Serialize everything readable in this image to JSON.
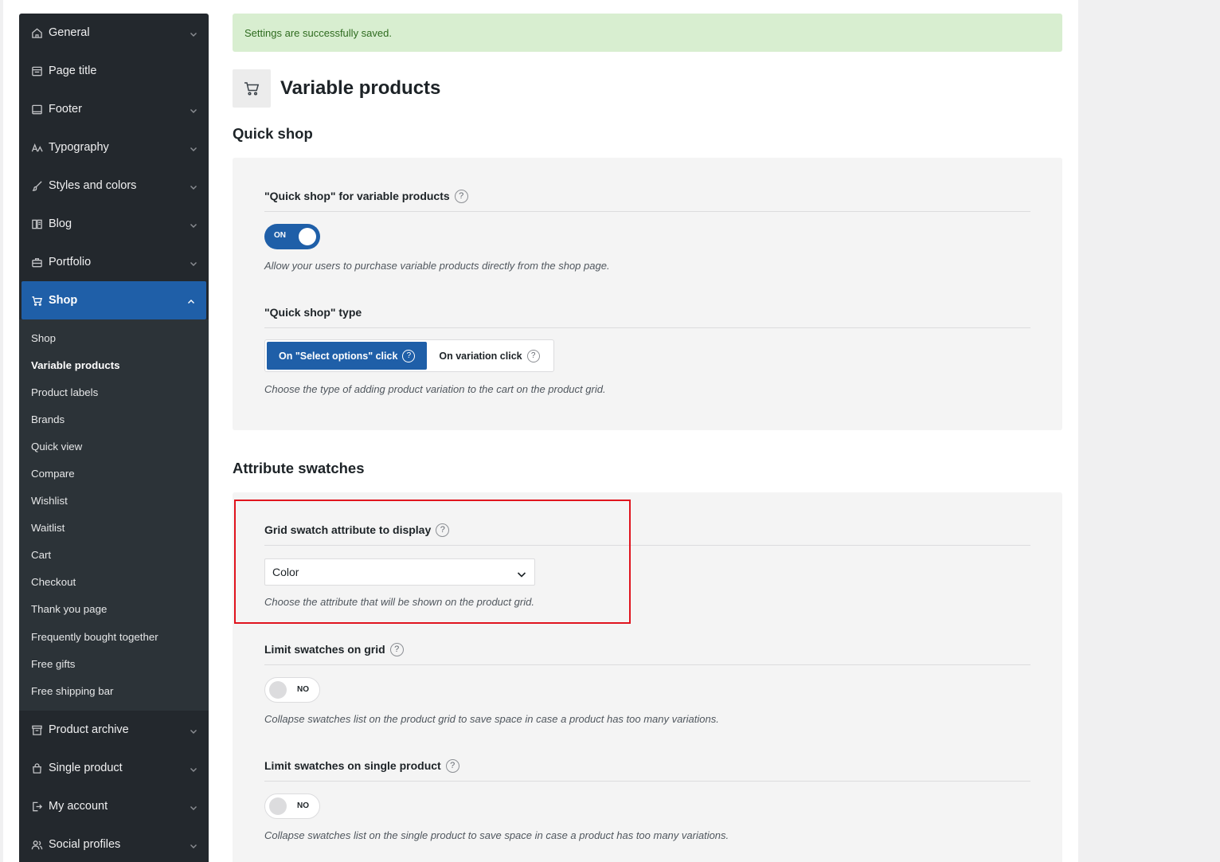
{
  "sidebar": {
    "items_top": [
      {
        "label": "General",
        "icon": "home-icon"
      },
      {
        "label": "Page title",
        "icon": "page-title-icon"
      },
      {
        "label": "Footer",
        "icon": "footer-icon"
      },
      {
        "label": "Typography",
        "icon": "typography-icon"
      },
      {
        "label": "Styles and colors",
        "icon": "brush-icon"
      },
      {
        "label": "Blog",
        "icon": "blog-icon"
      },
      {
        "label": "Portfolio",
        "icon": "portfolio-icon"
      }
    ],
    "active": {
      "label": "Shop",
      "icon": "cart-icon"
    },
    "sub_items": [
      "Shop",
      "Variable products",
      "Product labels",
      "Brands",
      "Quick view",
      "Compare",
      "Wishlist",
      "Waitlist",
      "Cart",
      "Checkout",
      "Thank you page",
      "Frequently bought together",
      "Free gifts",
      "Free shipping bar"
    ],
    "current_sub": "Variable products",
    "items_bottom": [
      {
        "label": "Product archive",
        "icon": "archive-icon"
      },
      {
        "label": "Single product",
        "icon": "bag-icon"
      },
      {
        "label": "My account",
        "icon": "account-icon"
      },
      {
        "label": "Social profiles",
        "icon": "users-icon"
      }
    ]
  },
  "notice": "Settings are successfully saved.",
  "page": {
    "title": "Variable products",
    "icon": "cart-icon"
  },
  "sections": {
    "quick_shop": {
      "title": "Quick shop",
      "enable": {
        "label": "\"Quick shop\" for variable products",
        "toggle": "ON",
        "description": "Allow your users to purchase variable products directly from the shop page."
      },
      "type": {
        "label": "\"Quick shop\" type",
        "options": [
          "On \"Select options\" click",
          "On variation click"
        ],
        "selected": "On \"Select options\" click",
        "description": "Choose the type of adding product variation to the cart on the product grid."
      }
    },
    "swatches": {
      "title": "Attribute swatches",
      "grid_attribute": {
        "label": "Grid swatch attribute to display",
        "value": "Color",
        "description": "Choose the attribute that will be shown on the product grid."
      },
      "limit_grid": {
        "label": "Limit swatches on grid",
        "toggle": "NO",
        "description": "Collapse swatches list on the product grid to save space in case a product has too many variations."
      },
      "limit_single": {
        "label": "Limit swatches on single product",
        "toggle": "NO",
        "description": "Collapse swatches list on the single product to save space in case a product has too many variations."
      }
    }
  },
  "help_glyph": "?",
  "colors": {
    "accent": "#1f5fa8",
    "sidebar": "#23282d",
    "notice_bg": "#d8eed0",
    "highlight": "#e0141e"
  }
}
